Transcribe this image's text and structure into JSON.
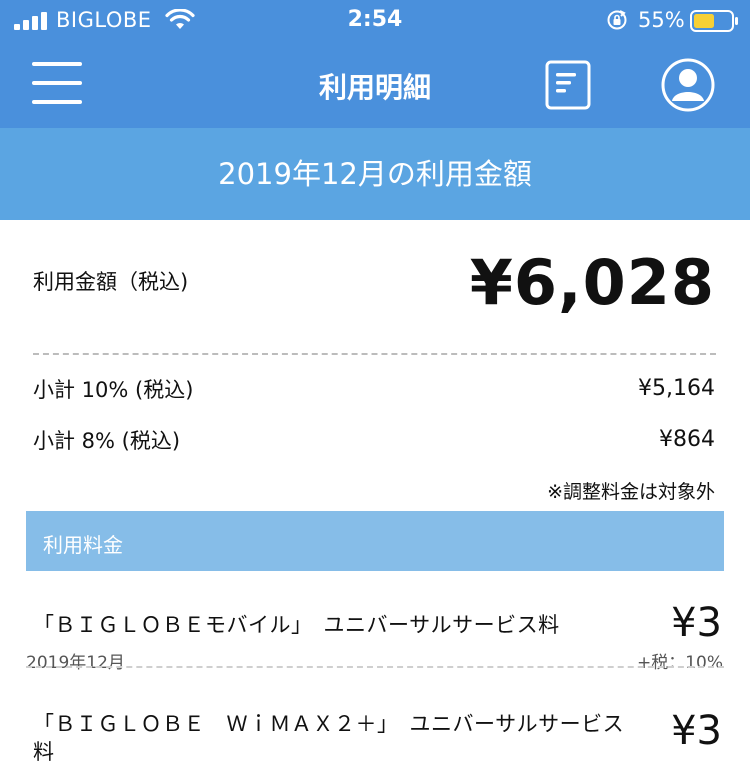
{
  "status_bar": {
    "carrier": "BIGLOBE",
    "time": "2:54",
    "battery": "55%"
  },
  "nav": {
    "title": "利用明細",
    "menu_icon": "hamburger-menu-icon",
    "doc_icon": "document-icon",
    "user_icon": "user-account-icon"
  },
  "header": {
    "month_title": "2019年12月の利用金額"
  },
  "summary": {
    "total_label": "利用金額（税込)",
    "total_amount": "¥6,028",
    "subtotals": [
      {
        "label": "小計 10% (税込)",
        "value": "¥5,164"
      },
      {
        "label": "小計 8% (税込)",
        "value": "¥864"
      }
    ],
    "note": "※調整料金は対象外"
  },
  "section": {
    "title": "利用料金"
  },
  "items": [
    {
      "name": "「ＢＩＧＬＯＢＥモバイル」　ユニバーサルサービス料",
      "price": "¥3",
      "date": "2019年12月",
      "tax": "+税：10%"
    },
    {
      "name_line1": "「ＢＩＧＬＯＢＥ　ＷｉＭＡＸ２＋」　ユニバーサルサービス",
      "name_line2": "料",
      "price": "¥3"
    }
  ],
  "colors": {
    "primary": "#4a90dc",
    "header_band": "#5ba5e2",
    "section_band": "#86bde8"
  }
}
